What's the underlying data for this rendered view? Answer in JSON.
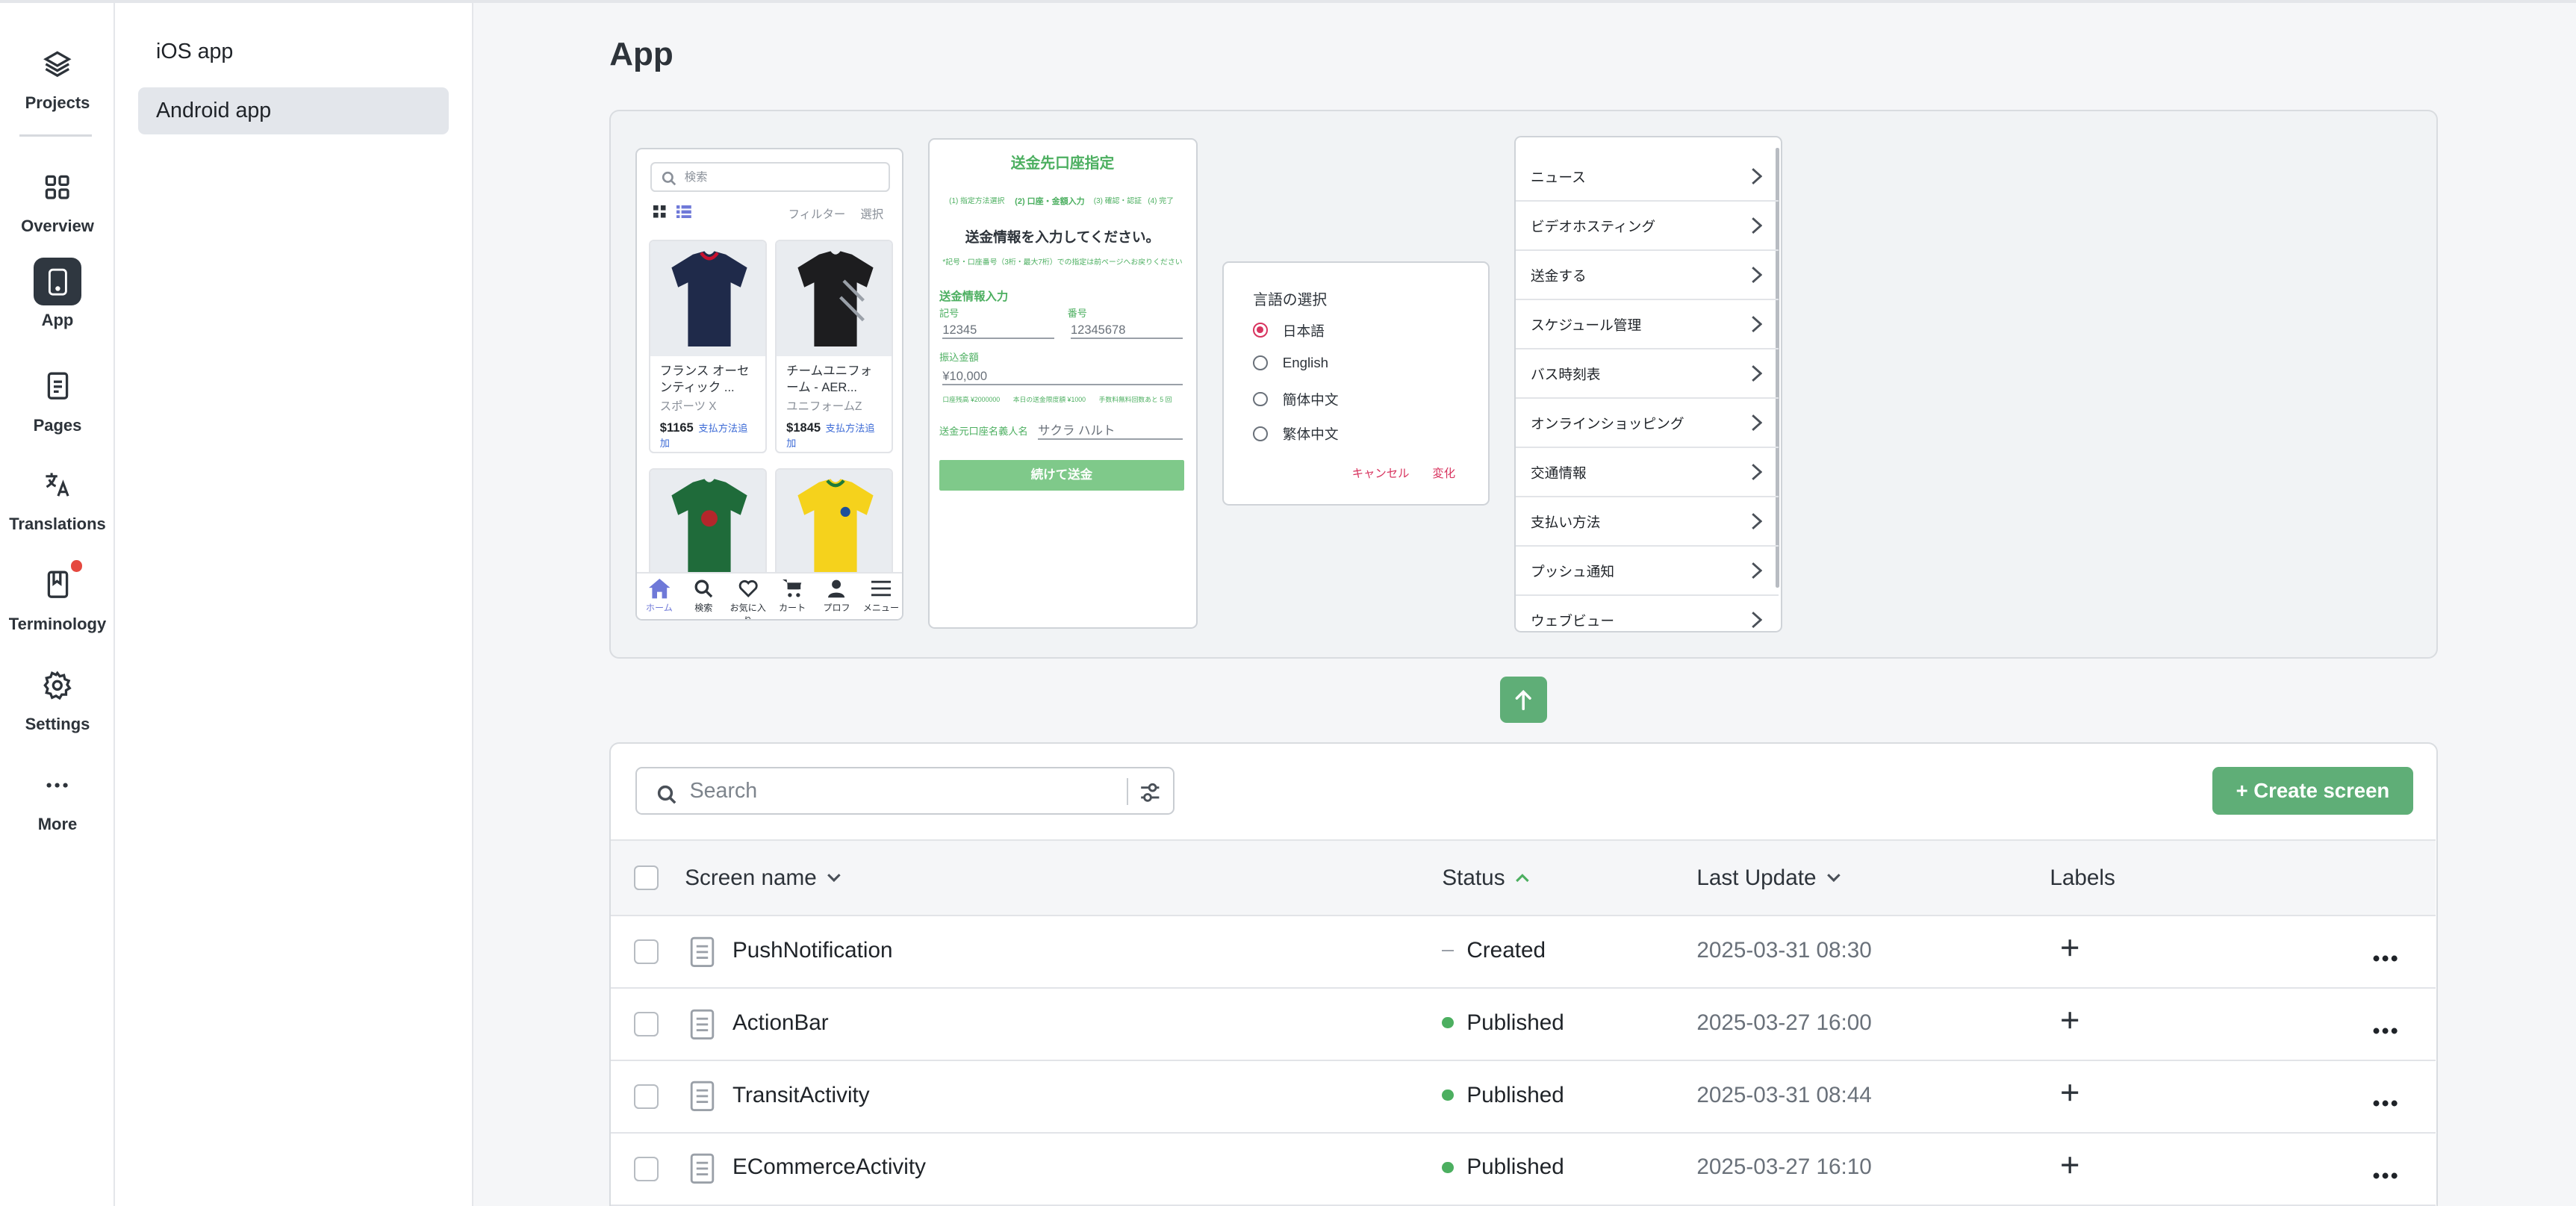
{
  "rail": {
    "items": [
      {
        "label": "Projects",
        "icon": "layers-icon"
      },
      {
        "label": "Overview",
        "icon": "grid-icon"
      },
      {
        "label": "App",
        "icon": "phone-icon",
        "active": true
      },
      {
        "label": "Pages",
        "icon": "document-icon"
      },
      {
        "label": "Translations",
        "icon": "translate-icon"
      },
      {
        "label": "Terminology",
        "icon": "book-icon",
        "notification": true
      },
      {
        "label": "Settings",
        "icon": "gear-icon"
      },
      {
        "label": "More",
        "icon": "ellipsis-icon"
      }
    ]
  },
  "subnav": {
    "items": [
      {
        "label": "iOS app"
      },
      {
        "label": "Android app",
        "active": true
      }
    ]
  },
  "page": {
    "title": "App"
  },
  "preview": {
    "shop": {
      "search_placeholder": "検索",
      "filter": "フィルター",
      "select": "選択",
      "products": [
        {
          "name": "フランス オーセンティック ...",
          "brand": "スポーツ X",
          "price": "$1165",
          "pay": "支払方法追加"
        },
        {
          "name": "チームユニフォーム - AER...",
          "brand": "ユニフォームZ",
          "price": "$1845",
          "pay": "支払方法追加"
        }
      ],
      "tabs": [
        "ホーム",
        "検索",
        "お気に入り",
        "カート",
        "プロフ",
        "メニュー"
      ]
    },
    "transfer": {
      "title": "送金先口座指定",
      "steps": [
        "(1) 指定方法選択",
        "(2) 口座・金額入力",
        "(3) 確認・認証",
        "(4) 完了"
      ],
      "heading": "送金情報を入力してください。",
      "note": "*記号・口座番号（3桁・最大7桁）での指定は前ページへお戻りください",
      "section": "送金情報入力",
      "symbol_label": "記号",
      "symbol_value": "12345",
      "number_label": "番号",
      "number_value": "12345678",
      "amount_label": "振込金額",
      "amount_value": "¥10,000",
      "limits": "口座残高 ¥2000000　　本日の送金限度額 ¥1000　　手数料無料回数あと 5 回",
      "holder_label": "送金元口座名義人名",
      "holder_value": "サクラ ハルト",
      "button": "続けて送金"
    },
    "dialog": {
      "title": "言語の選択",
      "options": [
        "日本語",
        "English",
        "簡体中文",
        "繁体中文"
      ],
      "cancel": "キャンセル",
      "change": "変化"
    },
    "menu": {
      "items": [
        "ニュース",
        "ビデオホスティング",
        "送金する",
        "スケジュール管理",
        "バス時刻表",
        "オンラインショッピング",
        "交通情報",
        "支払い方法",
        "プッシュ通知",
        "ウェブビュー"
      ]
    }
  },
  "toolbar": {
    "search_placeholder": "Search",
    "create_label": "+ Create screen"
  },
  "table": {
    "headers": {
      "name": "Screen name",
      "status": "Status",
      "updated": "Last Update",
      "labels": "Labels"
    },
    "rows": [
      {
        "name": "PushNotification",
        "status": "Created",
        "updated": "2025-03-31 08:30"
      },
      {
        "name": "ActionBar",
        "status": "Published",
        "updated": "2025-03-27 16:00"
      },
      {
        "name": "TransitActivity",
        "status": "Published",
        "updated": "2025-03-31 08:44"
      },
      {
        "name": "ECommerceActivity",
        "status": "Published",
        "updated": "2025-03-27 16:10"
      }
    ]
  },
  "colors": {
    "accent": "#5fae77",
    "published": "#4caf60",
    "rail_active": "#2f3740"
  }
}
